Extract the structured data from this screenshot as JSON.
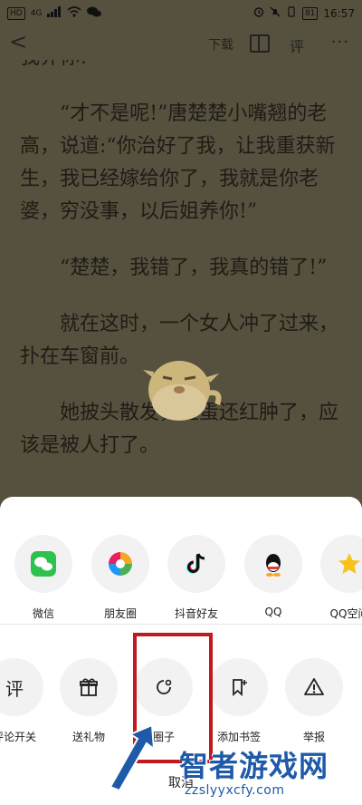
{
  "status": {
    "left_badges": [
      "HD",
      "4G"
    ],
    "battery": "81",
    "time": "16:57"
  },
  "topbar": {
    "back_label": "<",
    "download_label": "下载",
    "comment_label": "评",
    "more_label": "···"
  },
  "reader": {
    "line0": "我养你!",
    "paragraphs": [
      "“才不是呢!”唐楚楚小嘴翘的老",
      "高，说道:“你治好了我，让我重获新",
      "生，我已经嫁给你了，我就是你老",
      "婆，穷没事，以后姐养你!”",
      "“楚楚，我错了，我真的错了!”",
      "就在这时，一个女人冲了过来，",
      "扑在车窗前。",
      "她披头散发，脸蛋还红肿了，应",
      "该是被人打了。"
    ]
  },
  "share_row": [
    {
      "label": "微信",
      "icon": "wechat-icon"
    },
    {
      "label": "朋友圈",
      "icon": "moments-icon"
    },
    {
      "label": "抖音好友",
      "icon": "douyin-icon"
    },
    {
      "label": "QQ",
      "icon": "qq-icon"
    },
    {
      "label": "QQ空间",
      "icon": "qzone-icon"
    }
  ],
  "action_row": [
    {
      "label": "评论开关",
      "icon": "comment-toggle-icon"
    },
    {
      "label": "送礼物",
      "icon": "gift-icon"
    },
    {
      "label": "圈子",
      "icon": "circle-icon"
    },
    {
      "label": "添加书签",
      "icon": "add-bookmark-icon"
    },
    {
      "label": "举报",
      "icon": "report-icon"
    }
  ],
  "cancel_label": "取消",
  "watermark": {
    "title": "智者游戏网",
    "site": "zzslyyxcfy.com"
  },
  "colors": {
    "highlight": "#c0191f",
    "watermark": "#1e5aa7"
  }
}
